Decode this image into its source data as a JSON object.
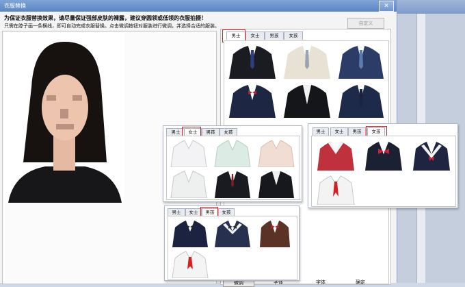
{
  "window": {
    "title": "衣服替换",
    "close_glyph": "✕"
  },
  "header": {
    "warning": "为保证衣服替换效果，请尽量保证强部皮肤的裸露，建议穿圆领或低领的衣服拍摄！",
    "hint": "只需在脖子画一条横线，即可自动完成衣服替换。点击微调按钮对服装进行微调，并选择合适的服装。",
    "custom_button": "自定义"
  },
  "main_panel": {
    "tabs": [
      "男士",
      "女士",
      "男孩",
      "女孩"
    ],
    "selected": 0
  },
  "panel_women": {
    "tabs": [
      "男士",
      "女士",
      "男孩",
      "女孩"
    ],
    "selected": 1
  },
  "panel_girls": {
    "tabs": [
      "男士",
      "女士",
      "男孩",
      "女孩"
    ],
    "selected": 3
  },
  "panel_boys": {
    "tabs": [
      "男士",
      "女士",
      "男孩",
      "女孩"
    ],
    "selected": 2
  },
  "bottom": {
    "button1": "微调",
    "status1": "字体",
    "status2": "字体",
    "status3": "确定"
  },
  "colors": {
    "highlight": "#e02020",
    "titlebar": "#5b86c4",
    "navy": "#1d2744",
    "black": "#15161a"
  }
}
